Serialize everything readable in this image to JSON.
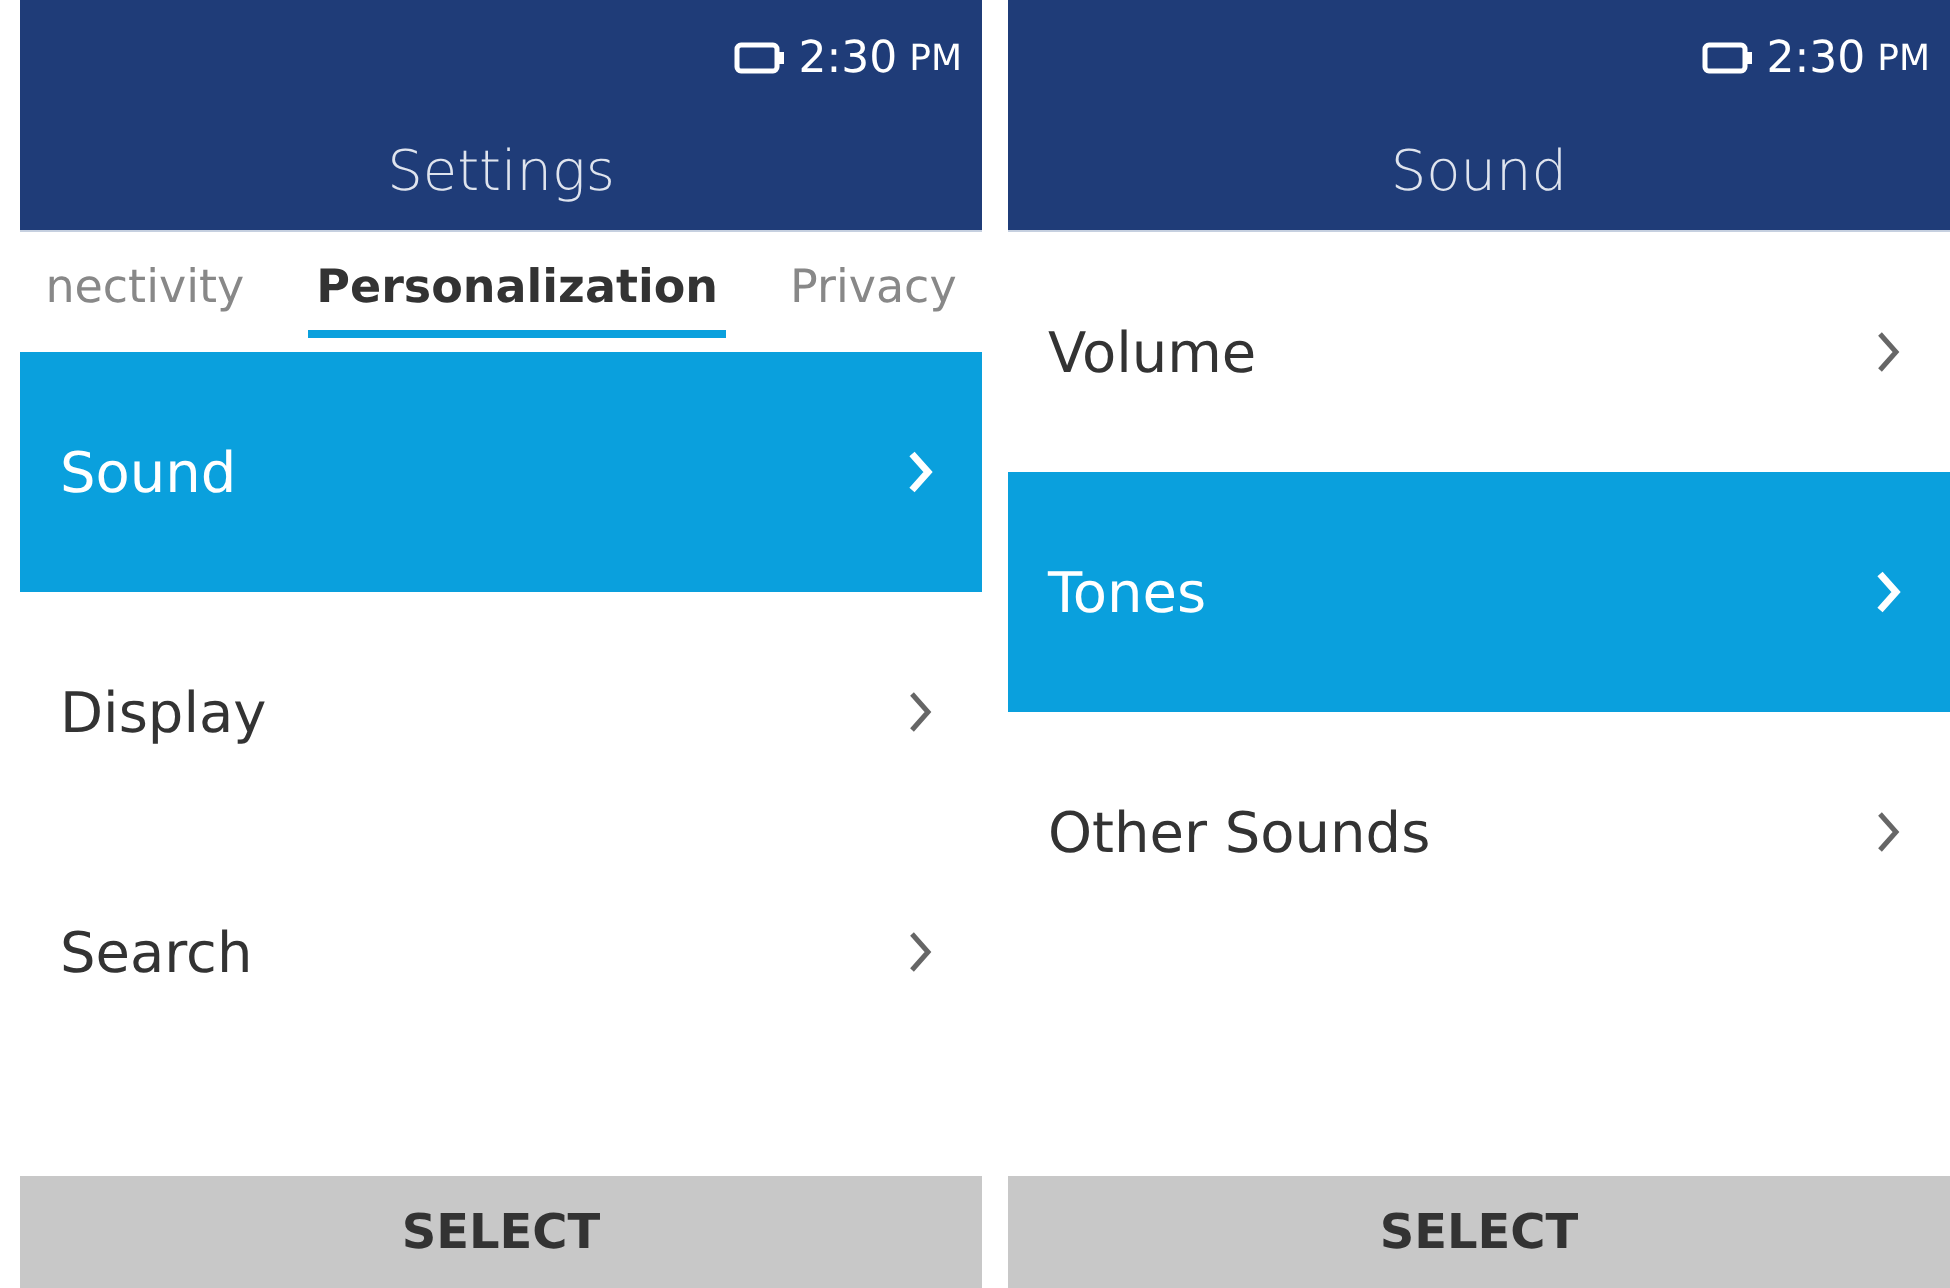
{
  "screens": [
    {
      "status": {
        "time": "2:30",
        "meridiem": "PM"
      },
      "title": "Settings",
      "tabs": [
        {
          "label": "nectivity",
          "selected": false
        },
        {
          "label": "Personalization",
          "selected": true
        },
        {
          "label": "Privacy",
          "selected": false
        }
      ],
      "items": [
        {
          "label": "Sound",
          "selected": true
        },
        {
          "label": "Display",
          "selected": false
        },
        {
          "label": "Search",
          "selected": false
        }
      ],
      "softkey": "SELECT"
    },
    {
      "status": {
        "time": "2:30",
        "meridiem": "PM"
      },
      "title": "Sound",
      "items": [
        {
          "label": "Volume",
          "selected": false
        },
        {
          "label": "Tones",
          "selected": true
        },
        {
          "label": "Other Sounds",
          "selected": false
        }
      ],
      "softkey": "SELECT"
    }
  ]
}
